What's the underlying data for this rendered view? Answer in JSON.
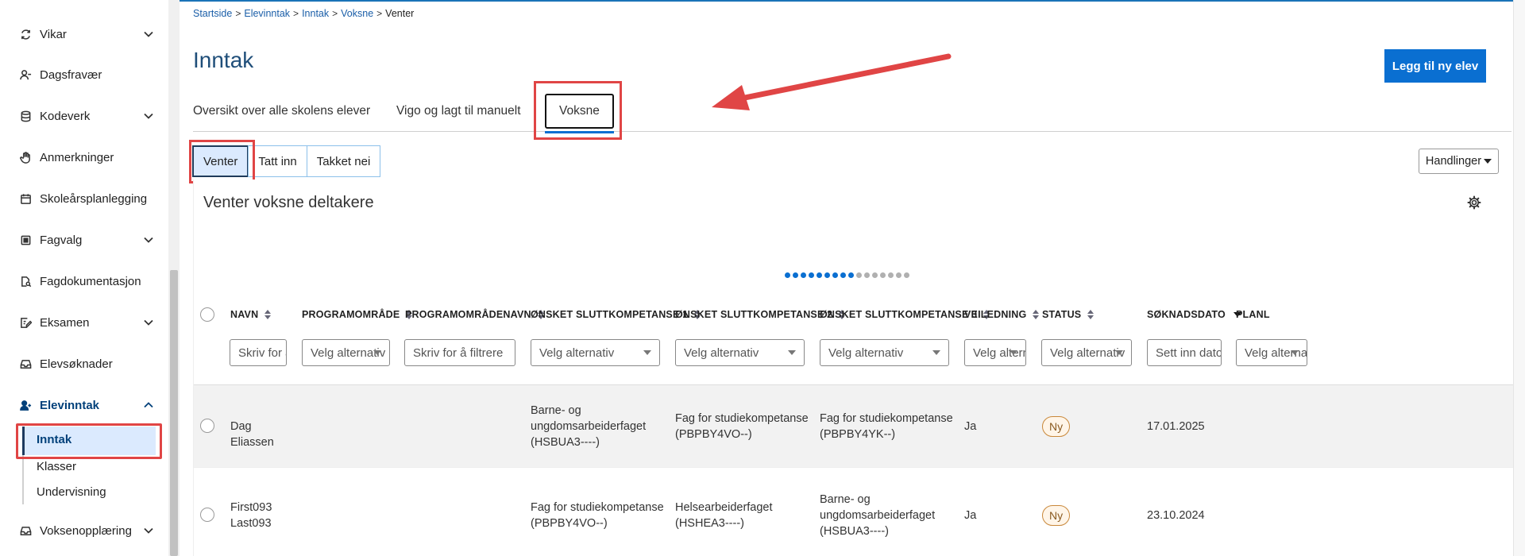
{
  "sidebar": {
    "items": [
      {
        "label": "Vikar",
        "icon": "refresh-icon",
        "expandable": true
      },
      {
        "label": "Dagsfravær",
        "icon": "user-minus-icon",
        "expandable": false
      },
      {
        "label": "Kodeverk",
        "icon": "database-icon",
        "expandable": true
      },
      {
        "label": "Anmerkninger",
        "icon": "hand-icon",
        "expandable": false
      },
      {
        "label": "Skoleårsplanlegging",
        "icon": "calendar-icon",
        "expandable": false
      },
      {
        "label": "Fagvalg",
        "icon": "checkbox-icon",
        "expandable": true
      },
      {
        "label": "Fagdokumentasjon",
        "icon": "document-search-icon",
        "expandable": false
      },
      {
        "label": "Eksamen",
        "icon": "edit-document-icon",
        "expandable": true
      },
      {
        "label": "Elevsøknader",
        "icon": "inbox-icon",
        "expandable": false
      },
      {
        "label": "Elevinntak",
        "icon": "user-add-icon",
        "expandable": true,
        "expanded": true
      },
      {
        "label": "Voksenopplæring",
        "icon": "inbox-icon",
        "expandable": true
      }
    ],
    "subitems": [
      "Inntak",
      "Klasser",
      "Undervisning"
    ]
  },
  "breadcrumb": {
    "items": [
      "Startside",
      "Elevinntak",
      "Inntak",
      "Voksne"
    ],
    "current": "Venter"
  },
  "page": {
    "title": "Inntak",
    "add_button": "Legg til ny elev"
  },
  "tabs": [
    "Oversikt over alle skolens elever",
    "Vigo og lagt til manuelt",
    "Voksne"
  ],
  "subtabs": [
    "Venter",
    "Tatt inn",
    "Takket nei"
  ],
  "actions_button": "Handlinger",
  "card": {
    "title": "Venter voksne deltakere"
  },
  "pagination_dots": {
    "total": 16,
    "active": 9
  },
  "table": {
    "headers": [
      "NAVN",
      "PROGRAMOMRÅDE",
      "PROGRAMOMRÅDENAVN",
      "ØNSKET SLUTTKOMPETANSE 1",
      "ØNSKET SLUTTKOMPETANSE 2",
      "ØNSKET SLUTTKOMPETANSE 3",
      "VEILEDNING",
      "STATUS",
      "SØKNADSDATO",
      "PLANL"
    ],
    "filters": [
      "Skriv for å filtrere",
      "Velg alternativ",
      "Skriv for å filtrere",
      "Velg alternativ",
      "Velg alternativ",
      "Velg alternativ",
      "Velg alternativ",
      "Velg alternativ",
      "Sett inn dato",
      "Velg alternativ"
    ],
    "rows": [
      {
        "name": "Dag Eliassen",
        "programomrade": "",
        "programomradenavn": "",
        "k1": "Barne- og ungdomsarbeiderfaget (HSBUA3----)",
        "k2": "Fag for studiekompetanse (PBPBY4VO--)",
        "k3": "Fag for studiekompetanse (PBPBY4YK--)",
        "veiledning": "Ja",
        "status": "Ny",
        "dato": "17.01.2025"
      },
      {
        "name": "First093 Last093",
        "programomrade": "",
        "programomradenavn": "",
        "k1": "Fag for studiekompetanse (PBPBY4VO--)",
        "k2": "Helsearbeiderfaget (HSHEA3----)",
        "k3": "Barne- og ungdomsarbeiderfaget (HSBUA3----)",
        "veiledning": "Ja",
        "status": "Ny",
        "dato": "23.10.2024"
      }
    ]
  },
  "colors": {
    "accent": "#0a6fd1",
    "title": "#1f4e79",
    "highlight": "#e04545",
    "badge_border": "#c9883a"
  }
}
